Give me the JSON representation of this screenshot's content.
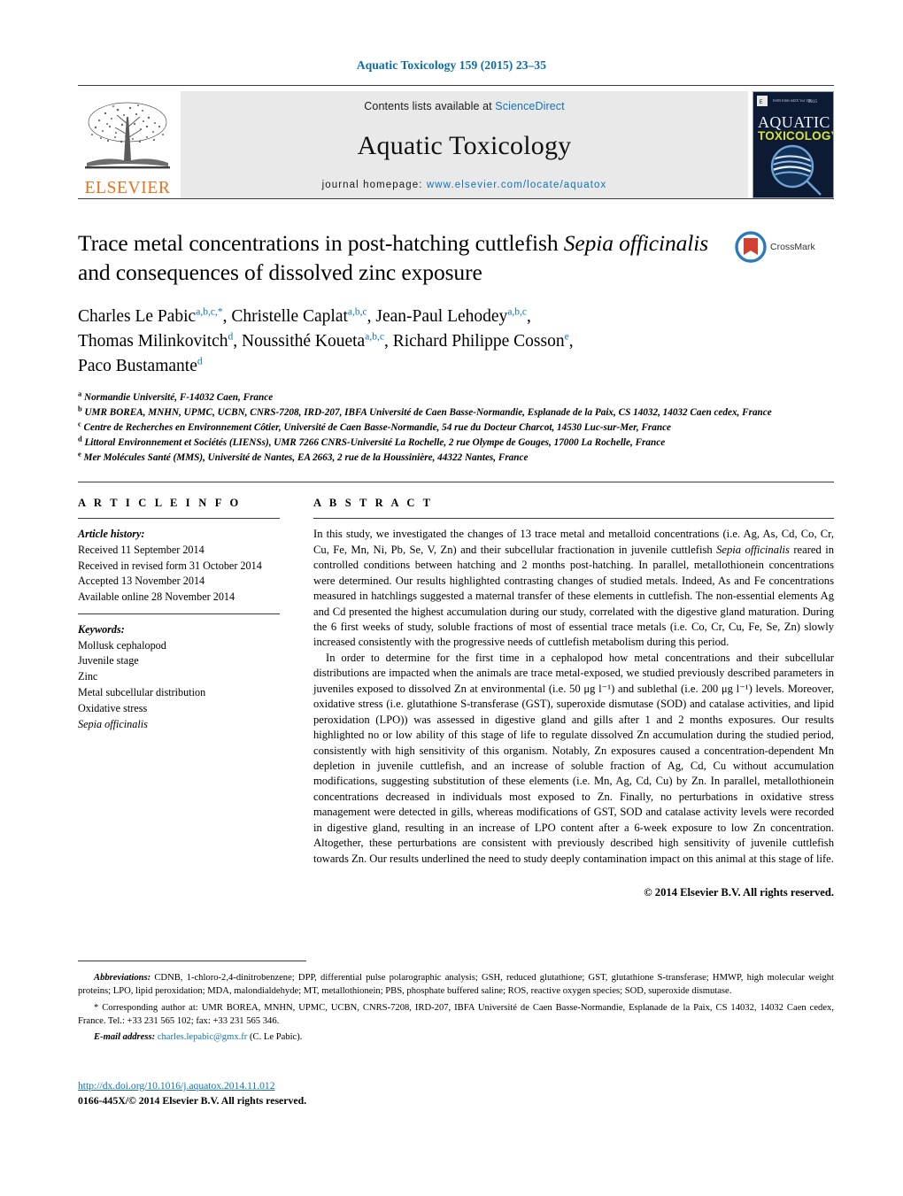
{
  "running_head": "Aquatic Toxicology 159 (2015) 23–35",
  "masthead": {
    "publisher_logo_text": "ELSEVIER",
    "contents_prefix": "Contents lists available at ",
    "contents_link": "ScienceDirect",
    "journal_title": "Aquatic Toxicology",
    "homepage_prefix": "journal homepage: ",
    "homepage_url": "www.elsevier.com/locate/aquatox",
    "cover_line1": "AQUATIC",
    "cover_line2": "TOXICOLOGY"
  },
  "article": {
    "title_line1_a": "Trace metal concentrations in post-hatching cuttlefish ",
    "title_line1_italic": "Sepia officinalis",
    "title_line2": "and consequences of dissolved zinc exposure",
    "crossmark_label": "CrossMark",
    "authors": [
      {
        "name": "Charles Le Pabic",
        "sup": "a,b,c,",
        "star": "*",
        "sep": ", "
      },
      {
        "name": "Christelle Caplat",
        "sup": "a,b,c",
        "star": "",
        "sep": ", "
      },
      {
        "name": "Jean-Paul Lehodey",
        "sup": "a,b,c",
        "star": "",
        "sep": ","
      },
      {
        "name": "Thomas Milinkovitch",
        "sup": "d",
        "star": "",
        "sep": ", "
      },
      {
        "name": "Noussithé Koueta",
        "sup": "a,b,c",
        "star": "",
        "sep": ", "
      },
      {
        "name": "Richard Philippe Cosson",
        "sup": "e",
        "star": "",
        "sep": ","
      },
      {
        "name": "Paco Bustamante",
        "sup": "d",
        "star": "",
        "sep": ""
      }
    ],
    "affiliations": [
      {
        "marker": "a",
        "text": "Normandie Université, F-14032 Caen, France"
      },
      {
        "marker": "b",
        "text": "UMR BOREA, MNHN, UPMC, UCBN, CNRS-7208, IRD-207, IBFA Université de Caen Basse-Normandie, Esplanade de la Paix, CS 14032, 14032 Caen cedex, France"
      },
      {
        "marker": "c",
        "text": "Centre de Recherches en Environnement Côtier, Université de Caen Basse-Normandie, 54 rue du Docteur Charcot, 14530 Luc-sur-Mer, France"
      },
      {
        "marker": "d",
        "text": "Littoral Environnement et Sociétés (LIENSs), UMR 7266 CNRS-Université La Rochelle, 2 rue Olympe de Gouges, 17000 La Rochelle, France"
      },
      {
        "marker": "e",
        "text": "Mer Molécules Santé (MMS), Université de Nantes, EA 2663, 2 rue de la Houssinière, 44322 Nantes, France"
      }
    ]
  },
  "article_info": {
    "heading": "A R T I C L E   I N F O",
    "history_label": "Article history:",
    "history": [
      "Received 11 September 2014",
      "Received in revised form 31 October 2014",
      "Accepted 13 November 2014",
      "Available online 28 November 2014"
    ],
    "keywords_label": "Keywords:",
    "keywords": [
      {
        "text": "Mollusk cephalopod",
        "italic": false
      },
      {
        "text": "Juvenile stage",
        "italic": false
      },
      {
        "text": "Zinc",
        "italic": false
      },
      {
        "text": "Metal subcellular distribution",
        "italic": false
      },
      {
        "text": "Oxidative stress",
        "italic": false
      },
      {
        "text": "Sepia officinalis",
        "italic": true
      }
    ]
  },
  "abstract": {
    "heading": "A B S T R A C T",
    "paragraph1_part1": "In this study, we investigated the changes of 13 trace metal and metalloid concentrations (i.e. Ag, As, Cd, Co, Cr, Cu, Fe, Mn, Ni, Pb, Se, V, Zn) and their subcellular fractionation in juvenile cuttlefish ",
    "paragraph1_italic1": "Sepia officinalis",
    "paragraph1_part2": " reared in controlled conditions between hatching and 2 months post-hatching. In parallel, metallothionein concentrations were determined. Our results highlighted contrasting changes of studied metals. Indeed, As and Fe concentrations measured in hatchlings suggested a maternal transfer of these elements in cuttlefish. The non-essential elements Ag and Cd presented the highest accumulation during our study, correlated with the digestive gland maturation. During the 6 first weeks of study, soluble fractions of most of essential trace metals (i.e. Co, Cr, Cu, Fe, Se, Zn) slowly increased consistently with the progressive needs of cuttlefish metabolism during this period.",
    "paragraph2": "In order to determine for the first time in a cephalopod how metal concentrations and their subcellular distributions are impacted when the animals are trace metal-exposed, we studied previously described parameters in juveniles exposed to dissolved Zn at environmental (i.e. 50 μg l⁻¹) and sublethal (i.e. 200 μg l⁻¹) levels. Moreover, oxidative stress (i.e. glutathione S-transferase (GST), superoxide dismutase (SOD) and catalase activities, and lipid peroxidation (LPO)) was assessed in digestive gland and gills after 1 and 2 months exposures. Our results highlighted no or low ability of this stage of life to regulate dissolved Zn accumulation during the studied period, consistently with high sensitivity of this organism. Notably, Zn exposures caused a concentration-dependent Mn depletion in juvenile cuttlefish, and an increase of soluble fraction of Ag, Cd, Cu without accumulation modifications, suggesting substitution of these elements (i.e. Mn, Ag, Cd, Cu) by Zn. In parallel, metallothionein concentrations decreased in individuals most exposed to Zn. Finally, no perturbations in oxidative stress management were detected in gills, whereas modifications of GST, SOD and catalase activity levels were recorded in digestive gland, resulting in an increase of LPO content after a 6-week exposure to low Zn concentration. Altogether, these perturbations are consistent with previously described high sensitivity of juvenile cuttlefish towards Zn. Our results underlined the need to study deeply contamination impact on this animal at this stage of life.",
    "copyright": "© 2014 Elsevier B.V. All rights reserved."
  },
  "footnotes": {
    "abbrev_label": "Abbreviations:",
    "abbrev_text": " CDNB, 1-chloro-2,4-dinitrobenzene; DPP, differential pulse polarographic analysis; GSH, reduced glutathione; GST, glutathione S-transferase; HMWP, high molecular weight proteins; LPO, lipid peroxidation; MDA, malondialdehyde; MT, metallothionein; PBS, phosphate buffered saline; ROS, reactive oxygen species; SOD, superoxide dismutase.",
    "corresponding_marker": "*",
    "corresponding_text": " Corresponding author at: UMR BOREA, MNHN, UPMC, UCBN, CNRS-7208, IRD-207, IBFA Université de Caen Basse-Normandie, Esplanade de la Paix, CS 14032, 14032 Caen cedex, France. Tel.: +33 231 565 102; fax: +33 231 565 346.",
    "email_label": "E-mail address:",
    "email_link": "charles.lepabic@gmx.fr",
    "email_suffix": " (C. Le Pabic)."
  },
  "footer": {
    "doi_url": "http://dx.doi.org/10.1016/j.aquatox.2014.11.012",
    "issn_line": "0166-445X/© 2014 Elsevier B.V. All rights reserved."
  },
  "colors": {
    "link_blue": "#1273b5",
    "elsevier_orange": "#E9711C",
    "cover_navy": "#0d1a33",
    "crossmark_red": "#d23f31",
    "crossmark_blue": "#2b7bba"
  }
}
